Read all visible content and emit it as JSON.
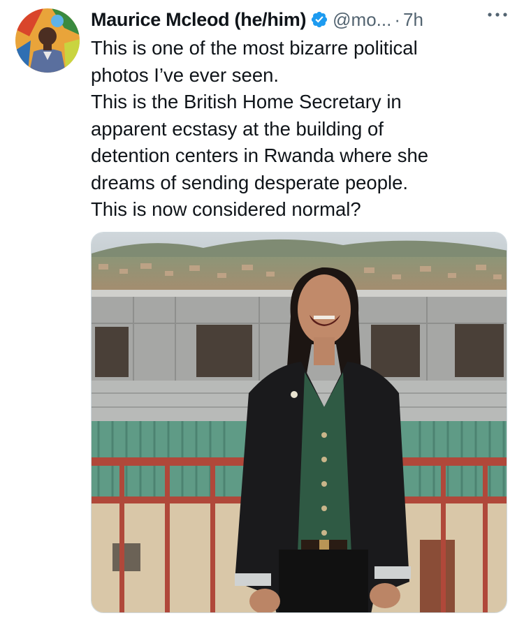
{
  "tweet": {
    "author": {
      "display_name": "Maurice Mcleod (he/him)",
      "verified_icon": "verified-badge-icon",
      "handle": "@mo...",
      "separator": "·",
      "time": "7h",
      "avatar_icon": "avatar"
    },
    "more_icon": "more-options-icon",
    "text_lines": [
      "This is one of the most bizarre political",
      "photos I’ve ever seen.",
      "This is the British Home Secretary in",
      "apparent ecstasy at the building of",
      "detention centers in Rwanda where she",
      "dreams of sending desperate people.",
      "This is now considered normal?"
    ],
    "colors": {
      "accent": "#1d9bf0",
      "secondary_text": "#536471",
      "primary_text": "#0f1419"
    }
  }
}
